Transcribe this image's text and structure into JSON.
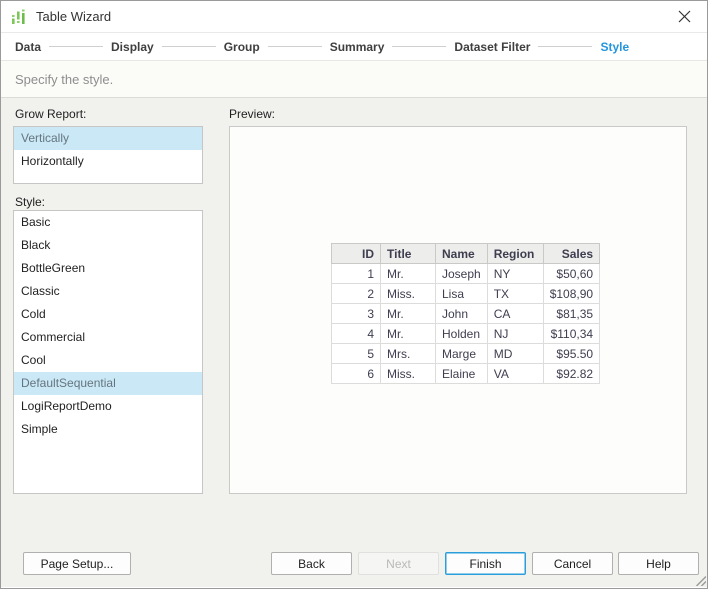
{
  "window": {
    "title": "Table Wizard"
  },
  "steps": [
    {
      "label": "Data",
      "active": false
    },
    {
      "label": "Display",
      "active": false
    },
    {
      "label": "Group",
      "active": false
    },
    {
      "label": "Summary",
      "active": false
    },
    {
      "label": "Dataset Filter",
      "active": false
    },
    {
      "label": "Style",
      "active": true
    }
  ],
  "subtitle": "Specify the style.",
  "grow_report": {
    "label": "Grow Report:",
    "options": [
      "Vertically",
      "Horizontally"
    ],
    "selected": "Vertically"
  },
  "style_list": {
    "label": "Style:",
    "options": [
      "Basic",
      "Black",
      "BottleGreen",
      "Classic",
      "Cold",
      "Commercial",
      "Cool",
      "DefaultSequential",
      "LogiReportDemo",
      "Simple"
    ],
    "selected": "DefaultSequential"
  },
  "preview": {
    "label": "Preview:",
    "table": {
      "columns": [
        "ID",
        "Title",
        "Name",
        "Region",
        "Sales"
      ],
      "rows": [
        [
          "1",
          "Mr.",
          "Joseph",
          "NY",
          "$50,60"
        ],
        [
          "2",
          "Miss.",
          "Lisa",
          "TX",
          "$108,90"
        ],
        [
          "3",
          "Mr.",
          "John",
          "CA",
          "$81,35"
        ],
        [
          "4",
          "Mr.",
          "Holden",
          "NJ",
          "$110,34"
        ],
        [
          "5",
          "Mrs.",
          "Marge",
          "MD",
          "$95.50"
        ],
        [
          "6",
          "Miss.",
          "Elaine",
          "VA",
          "$92.82"
        ]
      ]
    }
  },
  "footer": {
    "page_setup": "Page Setup...",
    "back": "Back",
    "next": "Next",
    "finish": "Finish",
    "cancel": "Cancel",
    "help": "Help",
    "next_enabled": false,
    "default_button": "Finish"
  },
  "colors": {
    "accent_blue": "#2496dd",
    "selection_blue": "#cbe8f7",
    "icon_green": "#7cc65a",
    "content_bg": "#f1f1ee"
  }
}
